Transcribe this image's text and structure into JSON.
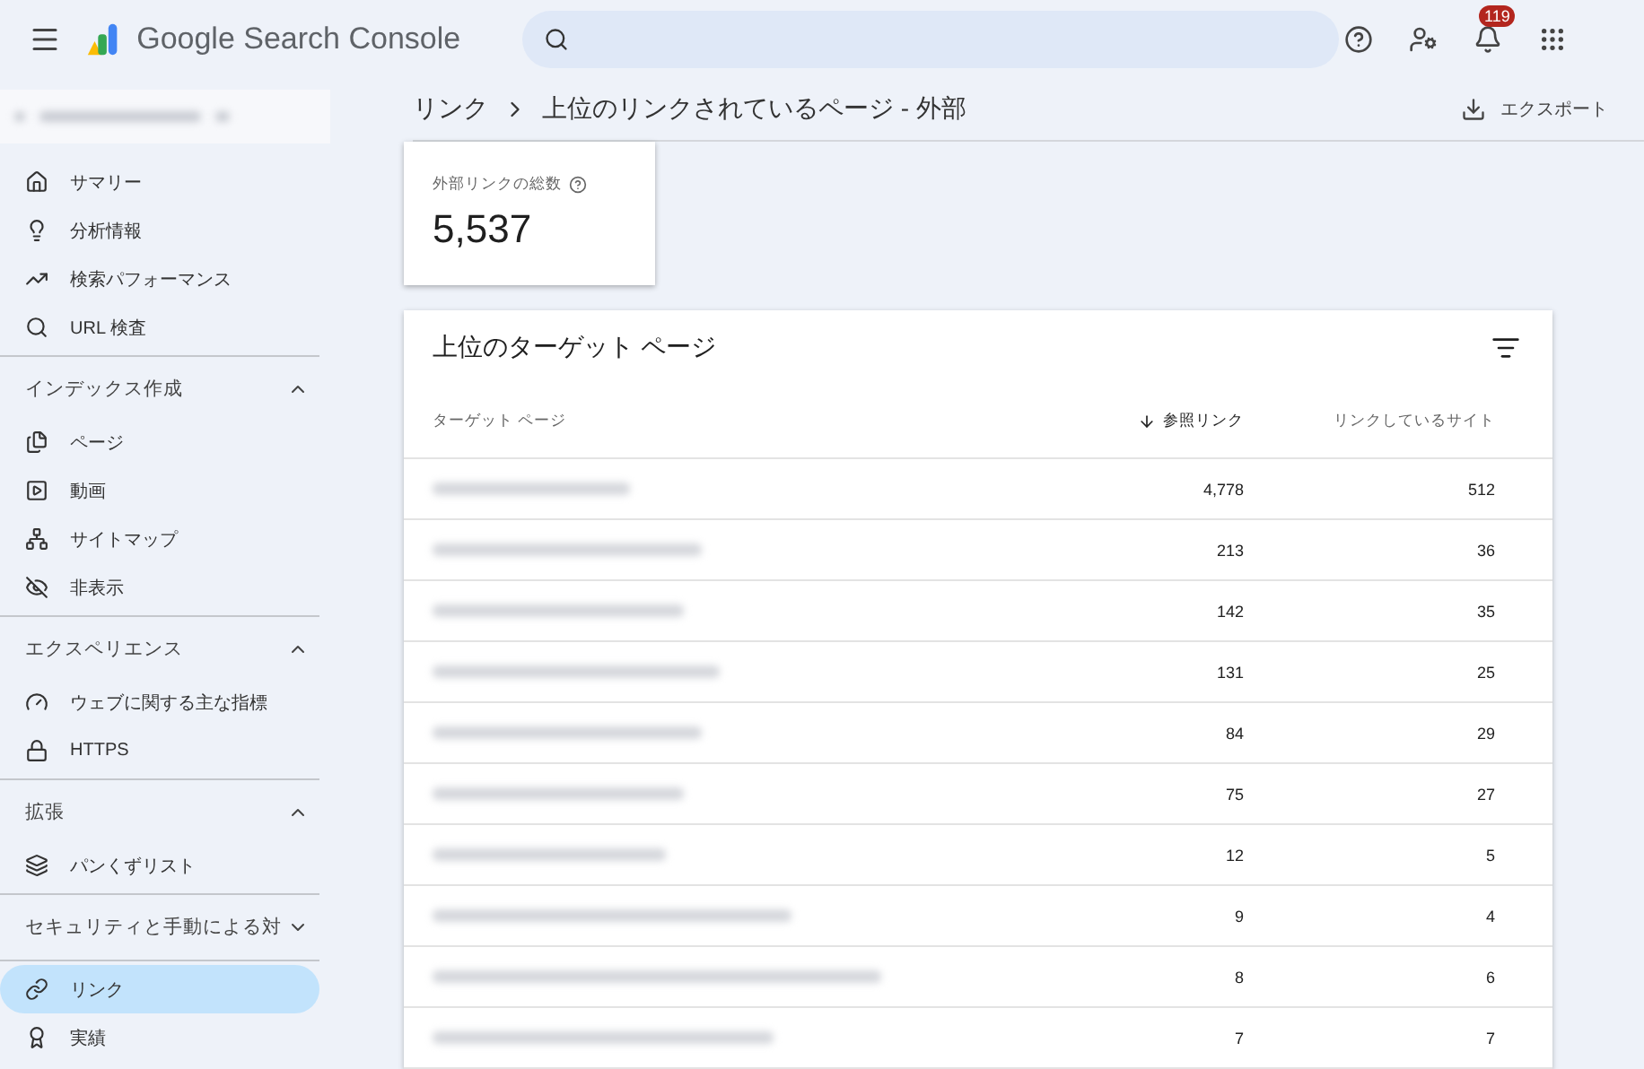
{
  "app": {
    "title": "Google Search Console",
    "notifications": "119"
  },
  "sidebar": {
    "groups": [
      {
        "items": [
          {
            "label": "サマリー",
            "selected": false
          },
          {
            "label": "分析情報",
            "selected": false
          },
          {
            "label": "検索パフォーマンス",
            "selected": false
          },
          {
            "label": "URL 検査",
            "selected": false
          }
        ]
      },
      {
        "title": "インデックス作成",
        "expanded": true,
        "items": [
          {
            "label": "ページ",
            "selected": false
          },
          {
            "label": "動画",
            "selected": false
          },
          {
            "label": "サイトマップ",
            "selected": false
          },
          {
            "label": "非表示",
            "selected": false
          }
        ]
      },
      {
        "title": "エクスペリエンス",
        "expanded": true,
        "items": [
          {
            "label": "ウェブに関する主な指標",
            "selected": false
          },
          {
            "label": "HTTPS",
            "selected": false
          }
        ]
      },
      {
        "title": "拡張",
        "expanded": true,
        "items": [
          {
            "label": "パンくずリスト",
            "selected": false
          }
        ]
      },
      {
        "title": "セキュリティと手動による対",
        "expanded": false
      },
      {
        "items": [
          {
            "label": "リンク",
            "selected": true
          },
          {
            "label": "実績",
            "selected": false
          }
        ]
      }
    ]
  },
  "breadcrumb": [
    "リンク",
    "上位のリンクされているページ - 外部"
  ],
  "export_label": "エクスポート",
  "summary": {
    "label": "外部リンクの総数",
    "value": "5,537"
  },
  "table": {
    "title": "上位のターゲット ページ",
    "columns": [
      {
        "label": "ターゲット ページ",
        "sorted": false
      },
      {
        "label": "参照リンク",
        "sorted": true
      },
      {
        "label": "リンクしているサイト",
        "sorted": false
      }
    ],
    "rows": [
      {
        "links": "4,778",
        "sites": "512"
      },
      {
        "links": "213",
        "sites": "36"
      },
      {
        "links": "142",
        "sites": "35"
      },
      {
        "links": "131",
        "sites": "25"
      },
      {
        "links": "84",
        "sites": "29"
      },
      {
        "links": "75",
        "sites": "27"
      },
      {
        "links": "12",
        "sites": "5"
      },
      {
        "links": "9",
        "sites": "4"
      },
      {
        "links": "8",
        "sites": "6"
      },
      {
        "links": "7",
        "sites": "7"
      }
    ]
  }
}
